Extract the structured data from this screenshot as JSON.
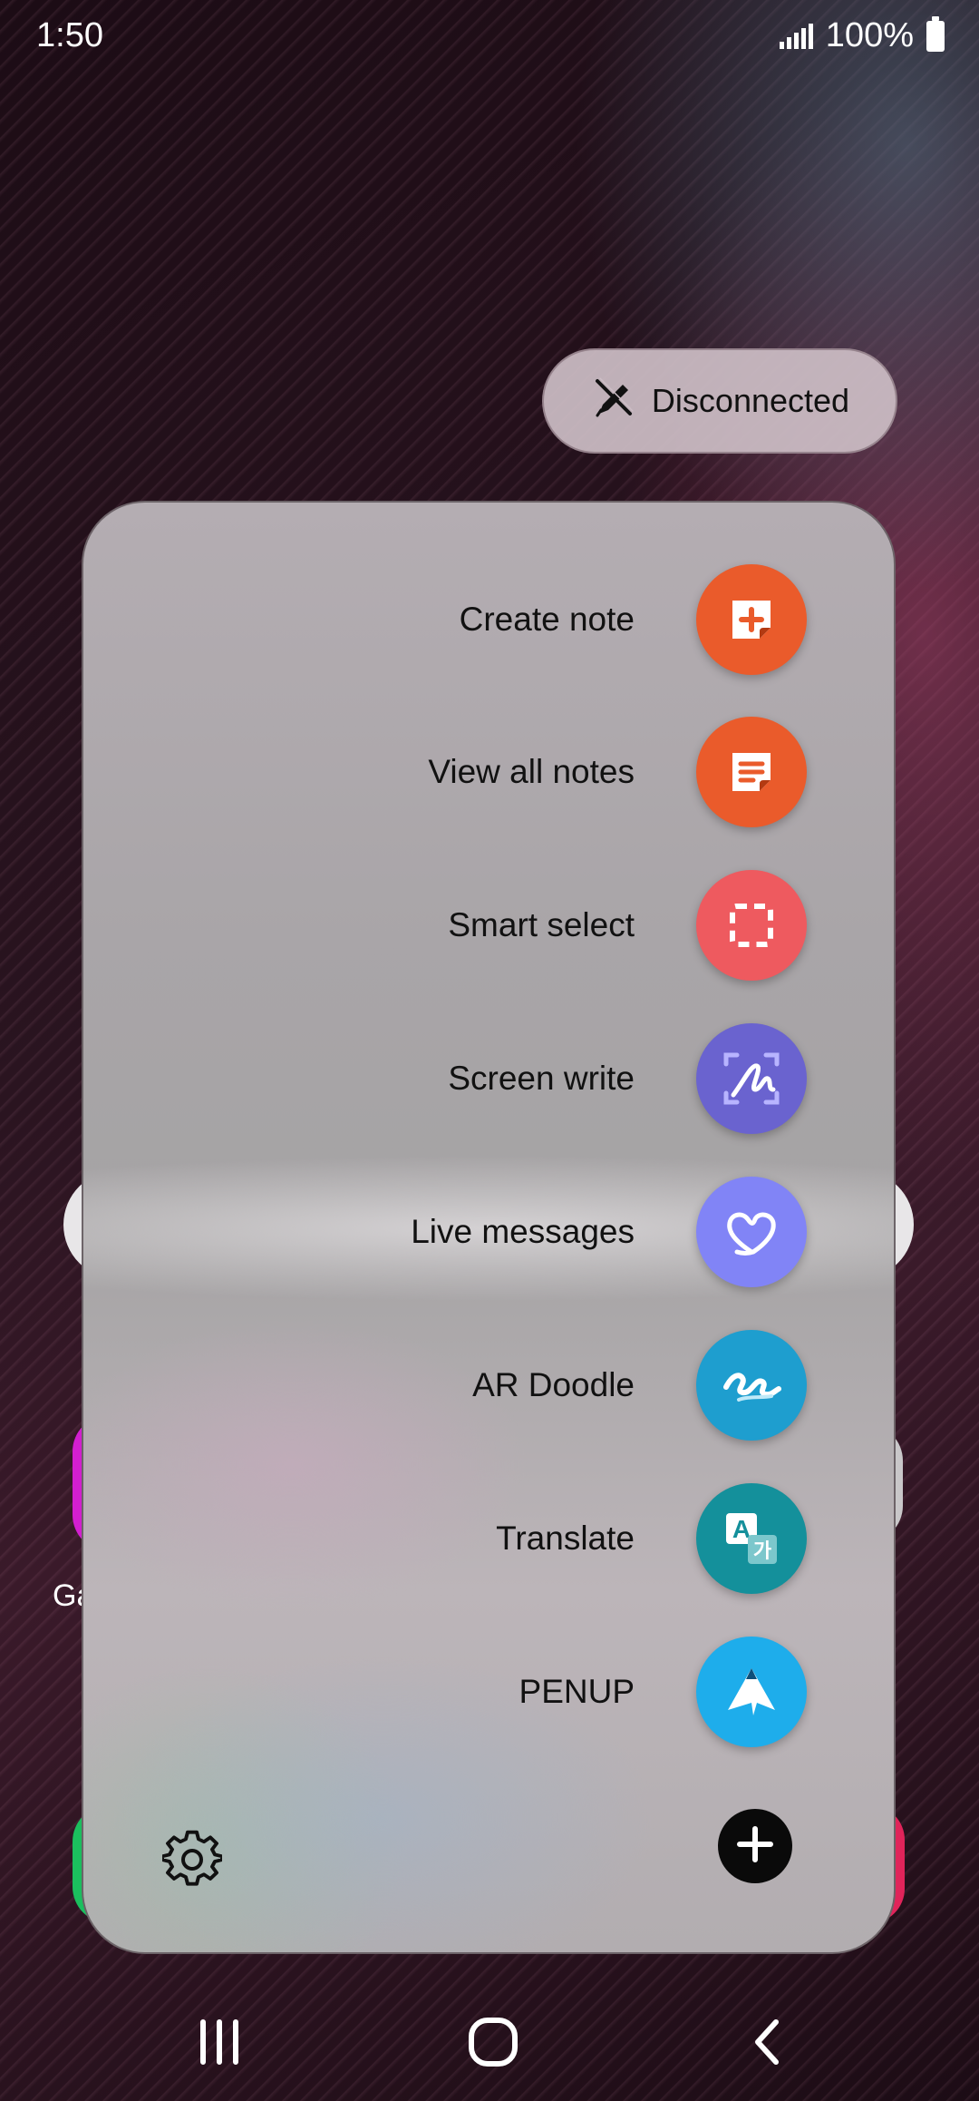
{
  "status_bar": {
    "time": "1:50",
    "battery_text": "100%"
  },
  "pen_status": {
    "label": "Disconnected",
    "icon": "pen-disconnected-icon"
  },
  "background_app": {
    "partial_label": "Ga"
  },
  "air_command": {
    "items": [
      {
        "label": "Create note",
        "icon": "create-note-icon",
        "color": "#EA5B2B"
      },
      {
        "label": "View all notes",
        "icon": "view-all-notes-icon",
        "color": "#EA5B2B"
      },
      {
        "label": "Smart select",
        "icon": "smart-select-icon",
        "color": "#EE5A5F"
      },
      {
        "label": "Screen write",
        "icon": "screen-write-icon",
        "color": "#6A63CF"
      },
      {
        "label": "Live messages",
        "icon": "live-messages-icon",
        "color": "#8184F6"
      },
      {
        "label": "AR Doodle",
        "icon": "ar-doodle-icon",
        "color": "#1E9ECF"
      },
      {
        "label": "Translate",
        "icon": "translate-icon",
        "color": "#14909B"
      },
      {
        "label": "PENUP",
        "icon": "penup-icon",
        "color": "#1EADEB"
      }
    ],
    "settings_icon": "gear-icon",
    "add_icon": "add-icon"
  },
  "nav_bar": {
    "recents_icon": "recents-icon",
    "home_icon": "home-icon",
    "back_icon": "back-icon"
  }
}
